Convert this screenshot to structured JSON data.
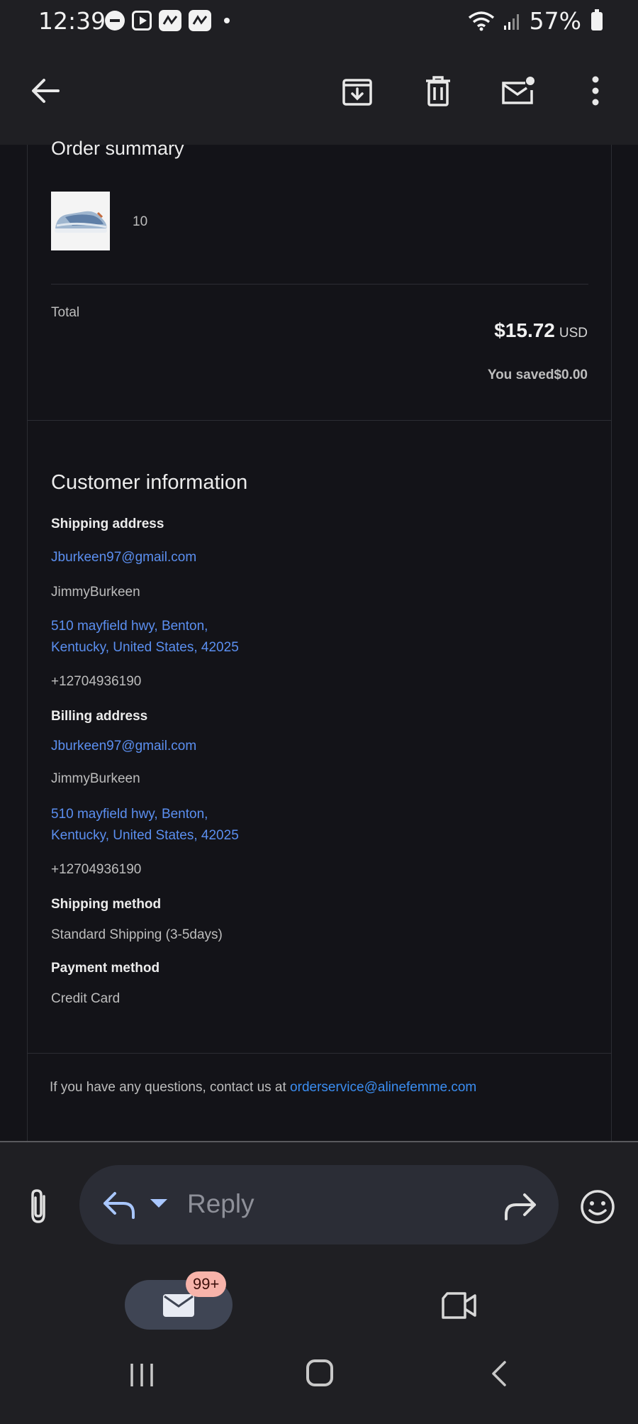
{
  "status_bar": {
    "time": "12:39",
    "battery": "57%",
    "icons": [
      "dnd-icon",
      "play-icon",
      "app-icon",
      "app-icon",
      "dot-icon",
      "wifi-icon",
      "signal-icon",
      "battery-icon"
    ]
  },
  "app_bar": {
    "icons": [
      "back-arrow-icon",
      "archive-icon",
      "delete-icon",
      "mark-unread-icon",
      "more-vert-icon"
    ]
  },
  "order": {
    "title": "Order summary",
    "item_quantity": "10",
    "total_label": "Total",
    "total_value": "$15.72",
    "total_currency": "USD",
    "saved": "You saved$0.00"
  },
  "customer": {
    "title": "Customer information",
    "shipping_label": "Shipping address",
    "shipping_email": "Jburkeen97@gmail.com",
    "shipping_name": "JimmyBurkeen",
    "shipping_address_line1": "510 mayfield hwy, Benton,",
    "shipping_address_line2": "Kentucky, United States, 42025",
    "shipping_phone": "+12704936190",
    "billing_label": "Billing address",
    "billing_email": "Jburkeen97@gmail.com",
    "billing_name": "JimmyBurkeen",
    "billing_address_line1": "510 mayfield hwy, Benton,",
    "billing_address_line2": "Kentucky, United States, 42025",
    "billing_phone": "+12704936190",
    "shipping_method_label": "Shipping method",
    "shipping_method": "Standard Shipping (3-5days)",
    "payment_method_label": "Payment method",
    "payment_method": "Credit Card"
  },
  "footer": {
    "contact_text": "If you have any questions, contact us at ",
    "contact_email": "orderservice@alinefemme.com"
  },
  "reply_bar": {
    "placeholder": "Reply"
  },
  "bottom_nav": {
    "mail_badge": "99+"
  },
  "colors": {
    "background": "#131318",
    "bar": "#1f1f23",
    "link": "#5b8ff0",
    "accent_link": "#3b8ef2",
    "badge": "#f7b3aa"
  }
}
